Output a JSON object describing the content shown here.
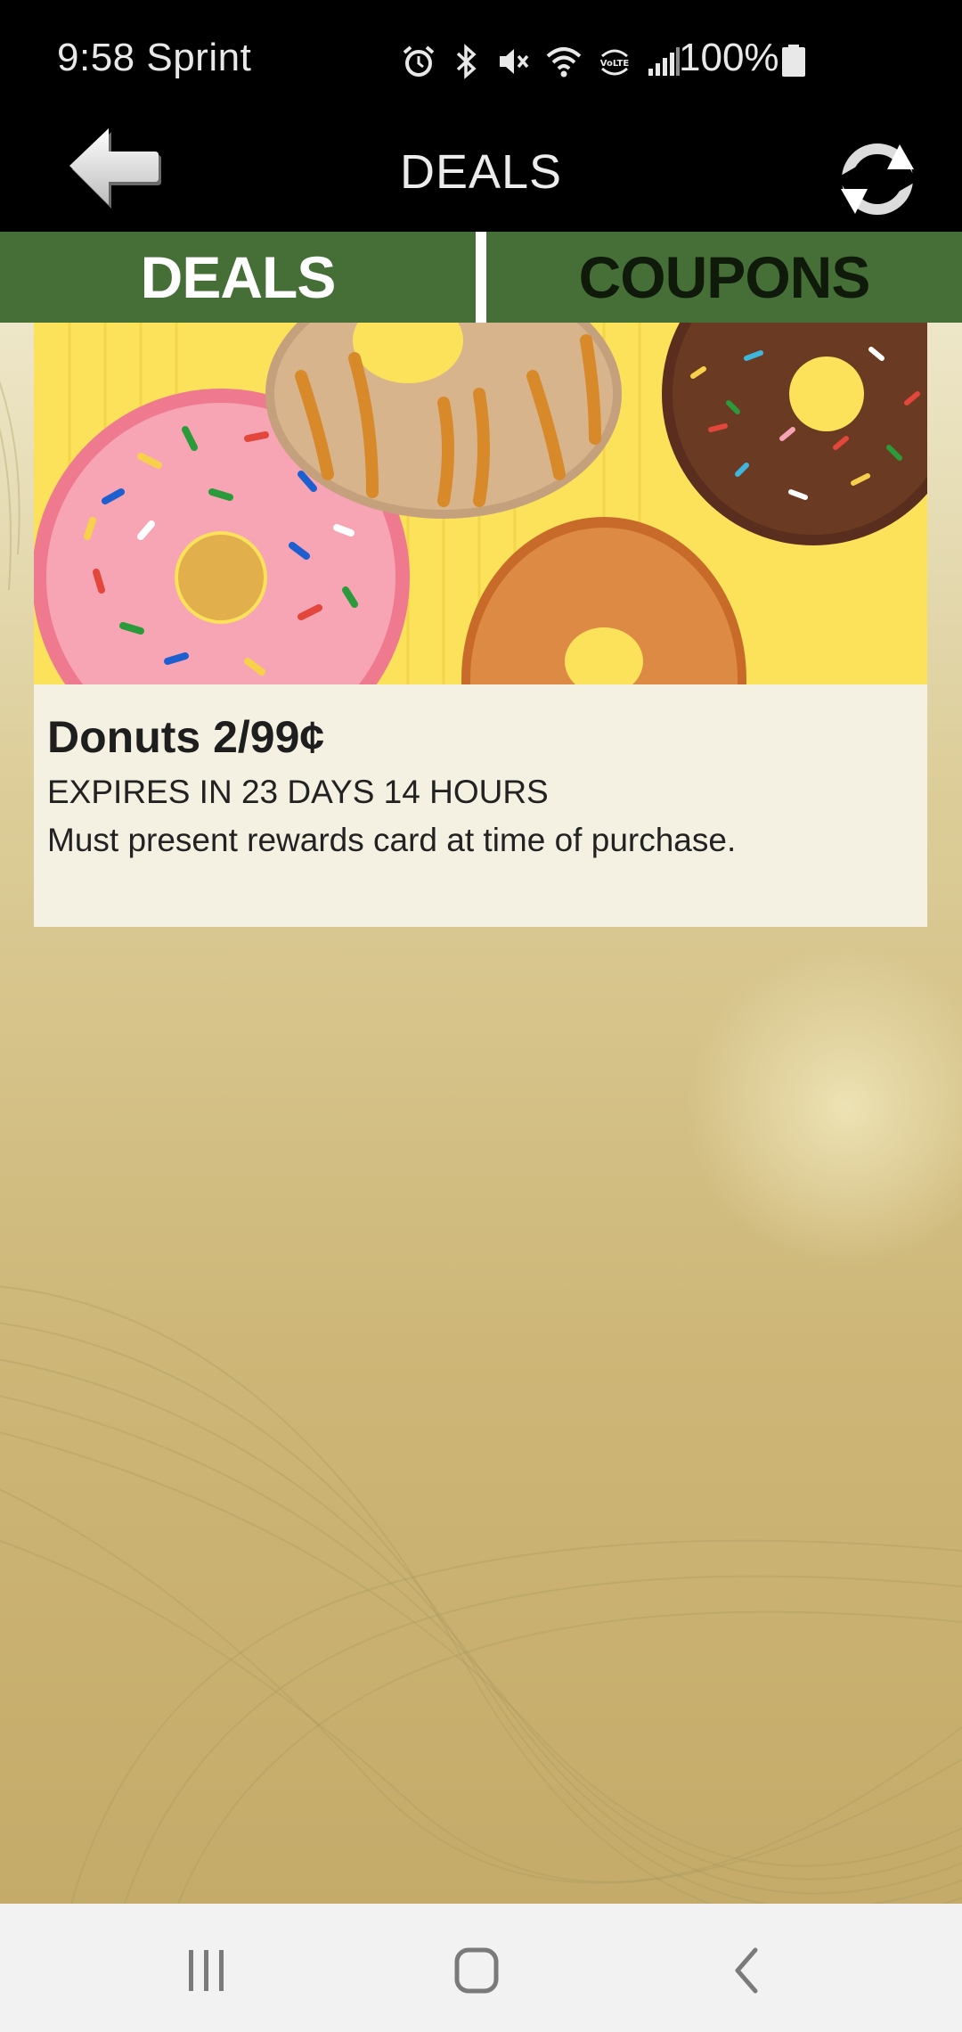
{
  "status_bar": {
    "time": "9:58",
    "carrier": "Sprint",
    "time_carrier": "9:58 Sprint",
    "battery_text": "100%",
    "icons": [
      "alarm-icon",
      "bluetooth-icon",
      "mute-icon",
      "wifi-icon",
      "volte-icon",
      "signal-icon",
      "battery-icon"
    ]
  },
  "header": {
    "title": "DEALS",
    "back_icon": "back-arrow-icon",
    "refresh_icon": "refresh-icon"
  },
  "tabs": [
    {
      "label": "DEALS",
      "active": true
    },
    {
      "label": "COUPONS",
      "active": false
    }
  ],
  "deals": [
    {
      "title": "Donuts 2/99¢",
      "expiry": "EXPIRES IN 23 DAYS 14 HOURS",
      "terms": "Must present rewards card at time of purchase."
    }
  ],
  "nav_bar": {
    "recents_icon": "recents-icon",
    "home_icon": "home-icon",
    "back_icon": "nav-back-icon"
  },
  "colors": {
    "tab_bar": "#466e37",
    "active_tab_text": "#ffffff",
    "inactive_tab_text": "#0f1a0a",
    "header_bg": "#000000",
    "card_bg": "#f4f1e3",
    "banner_bg": "#fbe25a"
  }
}
